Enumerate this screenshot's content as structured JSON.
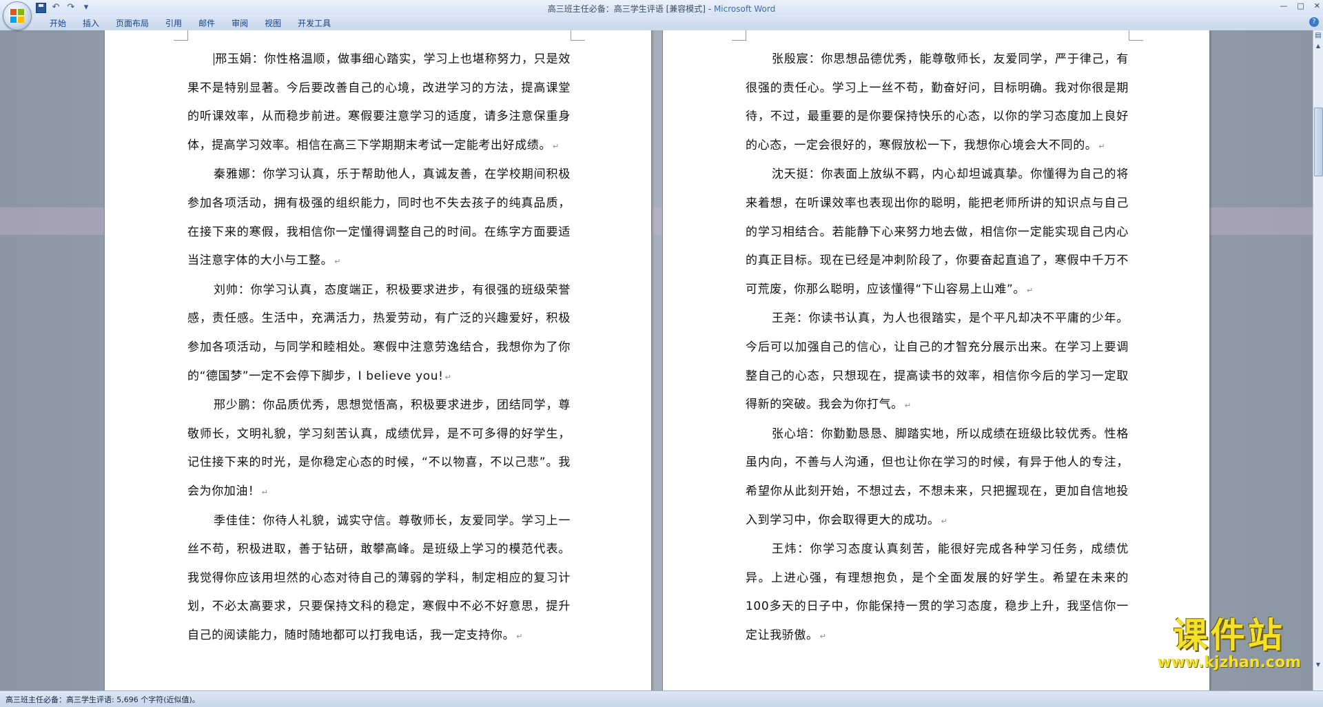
{
  "window": {
    "title": "高三班主任必备：高三学生评语 [兼容模式]",
    "separator": " - ",
    "app_name": "Microsoft Word",
    "controls": [
      "—",
      "□",
      "✕"
    ]
  },
  "quick_access": {
    "undo": "↶",
    "redo": "↷",
    "customize": "▾"
  },
  "ribbon": {
    "tabs": [
      "开始",
      "插入",
      "页面布局",
      "引用",
      "邮件",
      "审阅",
      "视图",
      "开发工具"
    ],
    "help": "?"
  },
  "document": {
    "left_page": [
      "邢玉娟：你性格温顺，做事细心踏实，学习上也堪称努力，只是效果不是特别显著。今后要改善自己的心境，改进学习的方法，提高课堂的听课效率，从而稳步前进。寒假要注意学习的适度，请多注意保重身体，提高学习效率。相信在高三下学期期末考试一定能考出好成绩。",
      "秦雅娜：你学习认真，乐于帮助他人，真诚友善，在学校期间积极参加各项活动，拥有极强的组织能力，同时也不失去孩子的纯真品质，在接下来的寒假，我相信你一定懂得调整自己的时间。在练字方面要适当注意字体的大小与工整。",
      "刘帅：你学习认真，态度端正，积极要求进步，有很强的班级荣誉感，责任感。生活中，充满活力，热爱劳动，有广泛的兴趣爱好，积极参加各项活动，与同学和睦相处。寒假中注意劳逸结合，我想你为了你的“德国梦”一定不会停下脚步，I believe you!",
      "邢少鹏：你品质优秀，思想觉悟高，积极要求进步，团结同学，尊敬师长，文明礼貌，学习刻苦认真，成绩优异，是不可多得的好学生，记住接下来的时光，是你稳定心态的时候，“不以物喜，不以己悲”。我会为你加油！",
      "季佳佳：你待人礼貌，诚实守信。尊敬师长，友爱同学。学习上一丝不苟，积极进取，善于钻研，敢攀高峰。是班级上学习的模范代表。我觉得你应该用坦然的心态对待自己的薄弱的学科，制定相应的复习计划，不必太高要求，只要保持文科的稳定，寒假中不必不好意思，提升自己的阅读能力，随时随地都可以打我电话，我一定支持你。"
    ],
    "right_page": [
      "张殷宸：你思想品德优秀，能尊敬师长，友爱同学，严于律己，有很强的责任心。学习上一丝不苟，勤奋好问，目标明确。我对你很是期待，不过，最重要的是你要保持快乐的心态，以你的学习态度加上良好的心态，一定会很好的，寒假放松一下，我想你心境会大不同的。",
      "沈天挺：你表面上放纵不羁，内心却坦诚真挚。你懂得为自己的将来着想，在听课效率也表现出你的聪明，能把老师所讲的知识点与自己的学习相结合。若能静下心来努力地去做，相信你一定能实现自己内心的真正目标。现在已经是冲刺阶段了，你要奋起直追了，寒假中千万不可荒废，你那么聪明，应该懂得“下山容易上山难”。",
      "王尧：你读书认真，为人也很踏实，是个平凡却决不平庸的少年。今后可以加强自己的信心，让自己的才智充分展示出来。在学习上要调整自己的心态，只想现在，提高读书的效率，相信你今后的学习一定取得新的突破。我会为你打气。",
      "张心培：你勤勤恳恳、脚踏实地，所以成绩在班级比较优秀。性格虽内向，不善与人沟通，但也让你在学习的时候，有异于他人的专注，希望你从此刻开始，不想过去，不想未来，只把握现在，更加自信地投入到学习中，你会取得更大的成功。",
      "王炜：你学习态度认真刻苦，能很好完成各种学习任务，成绩优异。上进心强，有理想抱负，是个全面发展的好学生。希望在未来的100多天的日子中，你能保持一贯的学习态度，稳步上升，我坚信你一定让我骄傲。"
    ]
  },
  "watermark": {
    "main": "课件站",
    "url": "www.kjzhan.com"
  },
  "statusbar": {
    "text": "高三班主任必备：高三学生评语: 5,696 个字符(近似值)。"
  }
}
